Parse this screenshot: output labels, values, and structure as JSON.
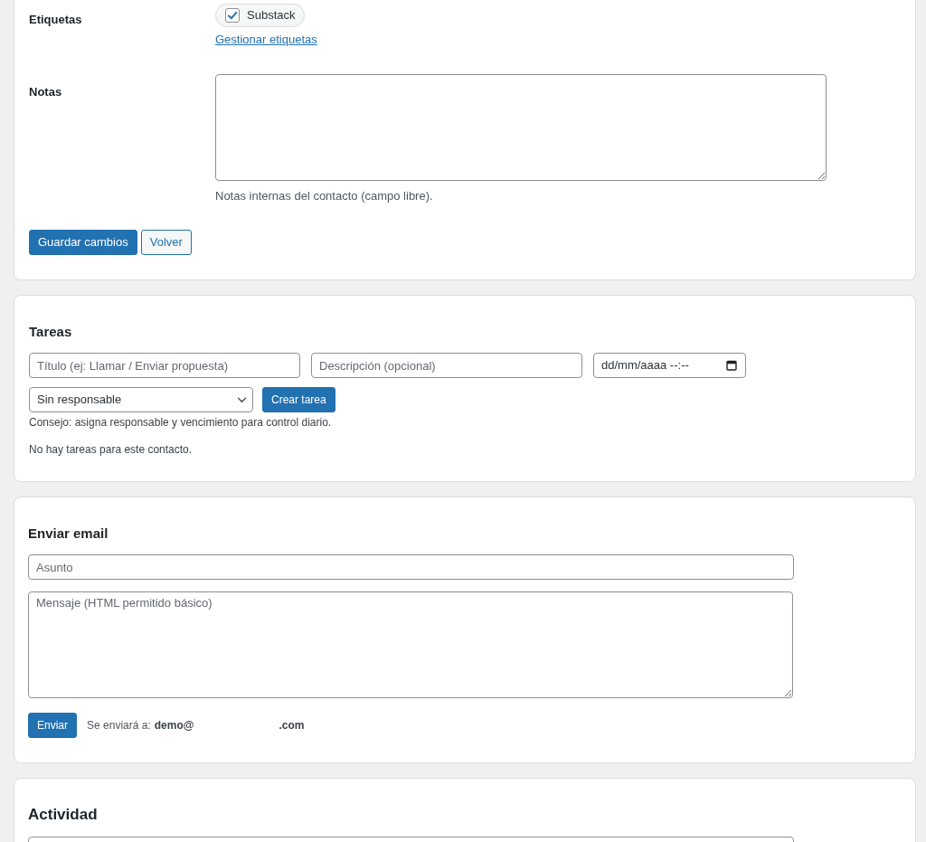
{
  "contact_form": {
    "tags_field": {
      "label": "Etiquetas",
      "tags": [
        {
          "label": "Substack",
          "checked": true
        }
      ],
      "link": "Gestionar etiquetas"
    },
    "notes_field": {
      "label": "Notas",
      "help": "Notas internas del contacto (campo libre)."
    },
    "buttons": [
      {
        "label": "Guardar cambios",
        "kind": "primary"
      },
      {
        "label": "Volver",
        "kind": "secondary"
      }
    ]
  },
  "tasks": {
    "title": "Tareas",
    "title_placeholder": "Título (ej: Llamar / Enviar propuesta)",
    "description_placeholder": "Descripción (opcional)",
    "due_field": "dd/mm/aaaa --:--",
    "assignee_select": "Sin responsable",
    "create_button": "Crear tarea",
    "tip": "Consejo: asigna responsable y vencimiento para control diario.",
    "empty_message": "No hay tareas para este contacto."
  },
  "email": {
    "title": "Enviar email",
    "subject_placeholder": "Asunto",
    "message_placeholder": "Mensaje (HTML permitido básico)",
    "send_button": "Enviar",
    "recipient_label": "Se enviará a:",
    "recipient_start": "demo@",
    "recipient_end": ".com"
  },
  "activity": {
    "title": "Actividad"
  }
}
